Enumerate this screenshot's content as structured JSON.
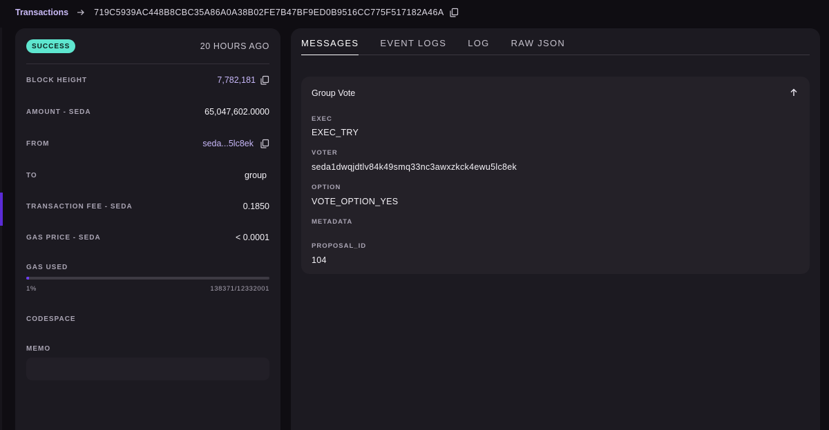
{
  "breadcrumb": {
    "root": "Transactions",
    "hash": "719C5939AC448B8CBC35A86A0A38B02FE7B47BF9ED0B9516CC775F517182A46A"
  },
  "summary": {
    "status": "SUCCESS",
    "time_ago": "20 HOURS AGO",
    "rows": [
      {
        "label": "BLOCK HEIGHT",
        "value": "7,782,181"
      },
      {
        "label": "AMOUNT - SEDA",
        "value": "65,047,602.0000"
      },
      {
        "label": "FROM",
        "value": "seda...5lc8ek"
      },
      {
        "label": "TO",
        "value": "group"
      },
      {
        "label": "TRANSACTION FEE - SEDA",
        "value": "0.1850"
      },
      {
        "label": "GAS PRICE - SEDA",
        "value": "< 0.0001"
      }
    ],
    "gas": {
      "label": "GAS USED",
      "percent_text": "1%",
      "ratio_text": "138371/12332001",
      "fraction": 0.0112
    },
    "codespace_label": "CODESPACE",
    "memo_label": "MEMO"
  },
  "tabs": [
    "MESSAGES",
    "EVENT LOGS",
    "LOG",
    "RAW JSON"
  ],
  "message": {
    "title": "Group Vote",
    "fields": [
      {
        "label": "EXEC",
        "value": "EXEC_TRY"
      },
      {
        "label": "VOTER",
        "value": "seda1dwqjdtlv84k49smq33nc3awxzkck4ewu5lc8ek"
      },
      {
        "label": "OPTION",
        "value": "VOTE_OPTION_YES"
      },
      {
        "label": "METADATA",
        "value": ""
      },
      {
        "label": "PROPOSAL_ID",
        "value": "104"
      }
    ]
  },
  "colors": {
    "background": "#0f0d12",
    "card": "#1c1a21",
    "accent": "#6d3ef0",
    "link": "#c6b6f7",
    "success": "#5ee6cf"
  },
  "icons": [
    "arrow-right-icon",
    "copy-icon",
    "chevron-up-icon"
  ]
}
